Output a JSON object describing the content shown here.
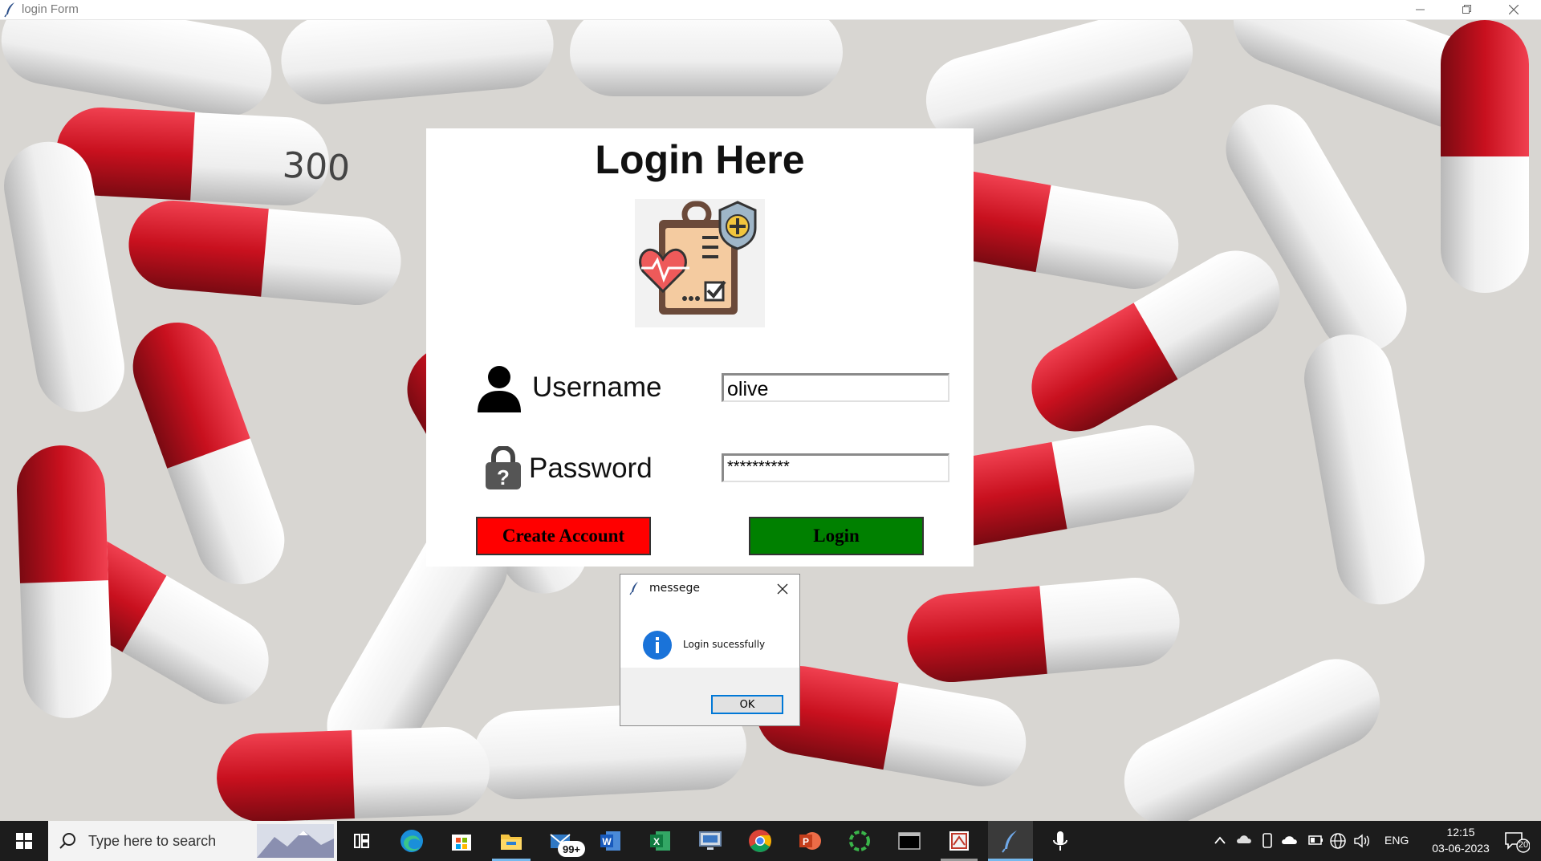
{
  "window": {
    "title": "login Form",
    "controls": [
      "minimize-icon",
      "restore-icon",
      "close-icon"
    ]
  },
  "background": {
    "capsule_print": "300"
  },
  "login": {
    "title": "Login Here",
    "logo_icon": "medical-record-icon",
    "username_label": "Username",
    "username_value": "olive",
    "password_label": "Password",
    "password_value": "**********",
    "create_account_label": "Create Account",
    "login_label": "Login",
    "colors": {
      "create_button": "#ff0000",
      "login_button": "#008000"
    }
  },
  "dialog": {
    "title": "messege",
    "message": "Login sucessfully",
    "icon": "info-icon",
    "ok_label": "OK"
  },
  "taskbar": {
    "search_placeholder": "Type here to search",
    "mail_badge": "99+",
    "apps": [
      "task-view-icon",
      "edge-icon",
      "store-icon",
      "file-explorer-icon",
      "mail-icon",
      "word-icon",
      "excel-icon",
      "remote-desktop-icon",
      "chrome-icon",
      "powerpoint-icon",
      "loading-app-icon",
      "terminal-icon",
      "snipping-tool-icon",
      "python-feather-icon",
      "microphone-icon"
    ],
    "tray": {
      "language": "ENG",
      "time": "12:15",
      "date": "03-06-2023",
      "notification_count": "20"
    }
  }
}
